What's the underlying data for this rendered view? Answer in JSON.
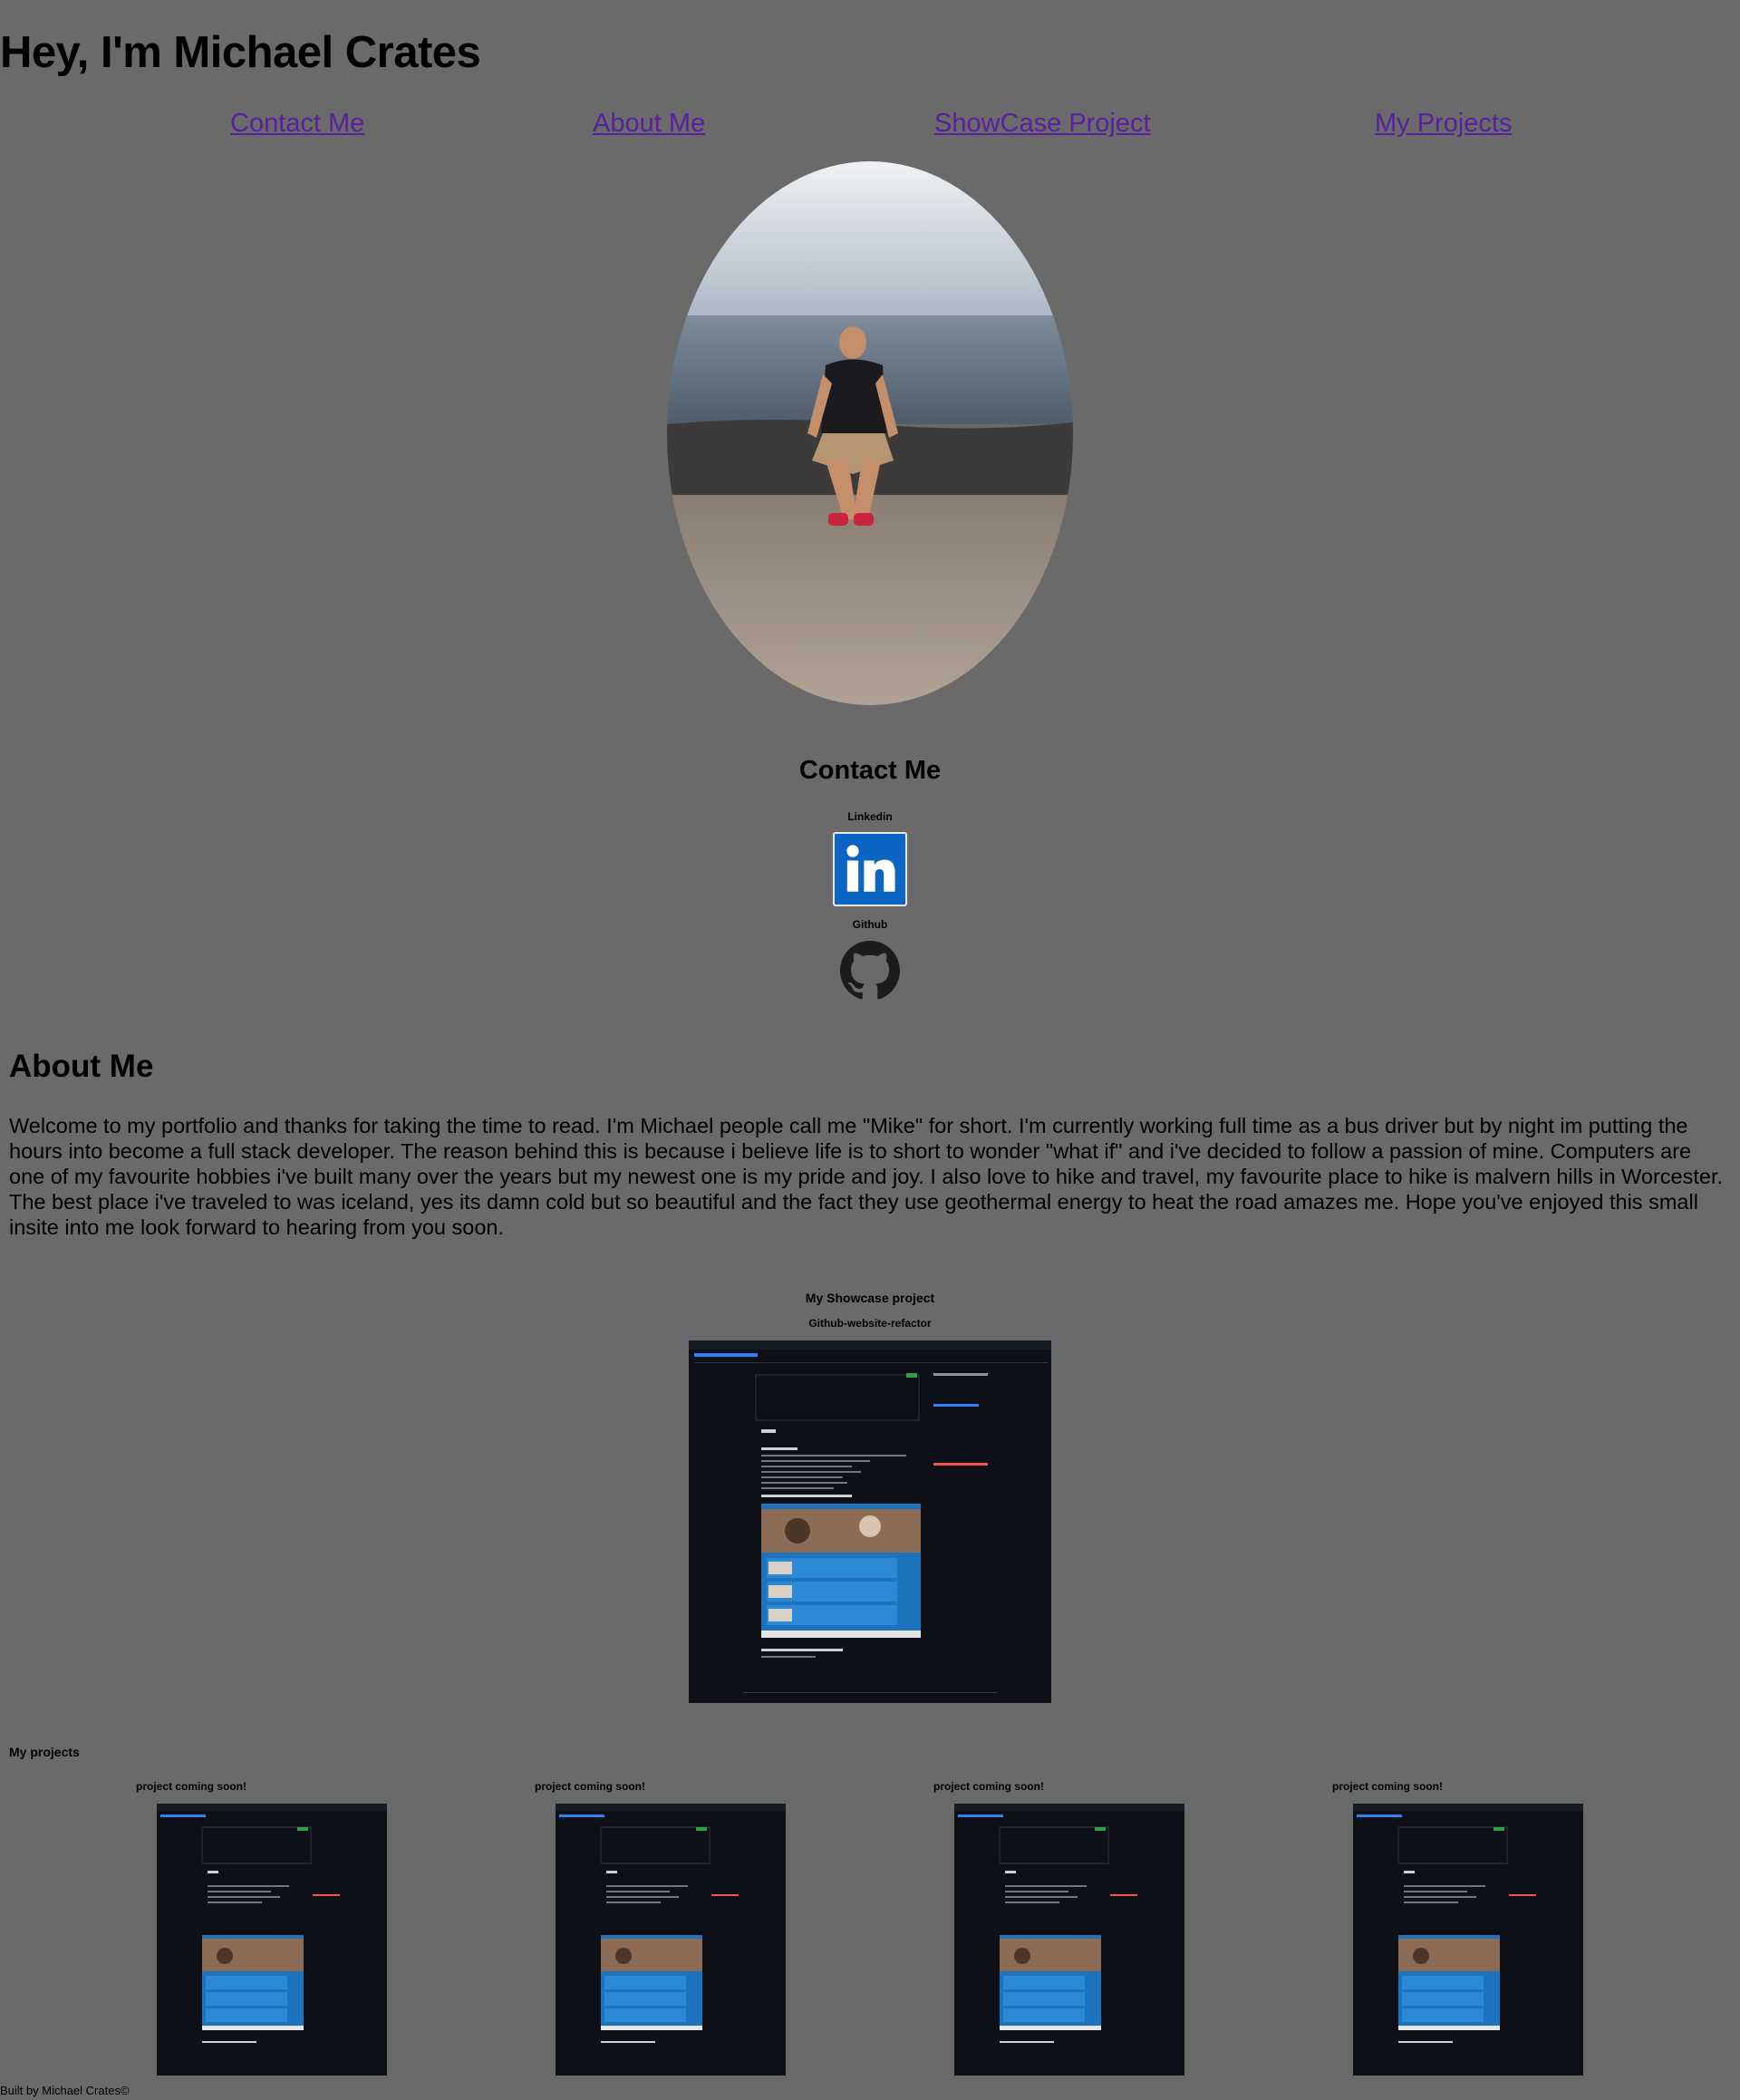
{
  "header": {
    "title": "Hey, I'm Michael Crates"
  },
  "nav": {
    "items": [
      {
        "label": "Contact Me"
      },
      {
        "label": "About Me"
      },
      {
        "label": "ShowCase Project"
      },
      {
        "label": "My Projects"
      }
    ],
    "link_color": "#5a1fa0"
  },
  "colors": {
    "page_background": "#6a6a6a",
    "linkedin_blue": "#0a66c2",
    "screenshot_dark": "#0d1117"
  },
  "profile": {
    "image": "profile-photo-by-the-sea"
  },
  "contact": {
    "heading": "Contact Me",
    "linkedin_label": "Linkedin",
    "linkedin_icon": "linkedin-icon",
    "github_label": "Github",
    "github_icon": "github-icon"
  },
  "about": {
    "heading": "About Me",
    "text": "Welcome to my portfolio and thanks for taking the time to read. I'm Michael people call me \"Mike\" for short. I'm currently working full time as a bus driver but by night im putting the hours into become a full stack developer. The reason behind this is because i believe life is to short to wonder \"what if\" and i've decided to follow a passion of mine. Computers are one of my favourite hobbies i've built many over the years but my newest one is my pride and joy. I also love to hike and travel, my favourite place to hike is malvern hills in Worcester. The best place i've traveled to was iceland, yes its damn cold but so beautiful and the fact they use geothermal energy to heat the road amazes me. Hope you've enjoyed this small insite into me look forward to hearing from you soon."
  },
  "showcase": {
    "heading": "My Showcase project",
    "project_name": "Github-website-refactor",
    "image": "github-repository-screenshot"
  },
  "projects": {
    "heading": "My projects",
    "items": [
      {
        "label": "project coming soon!"
      },
      {
        "label": "project coming soon!"
      },
      {
        "label": "project coming soon!"
      },
      {
        "label": "project coming soon!"
      }
    ]
  },
  "footer": {
    "text": "Built by Michael Crates©"
  }
}
